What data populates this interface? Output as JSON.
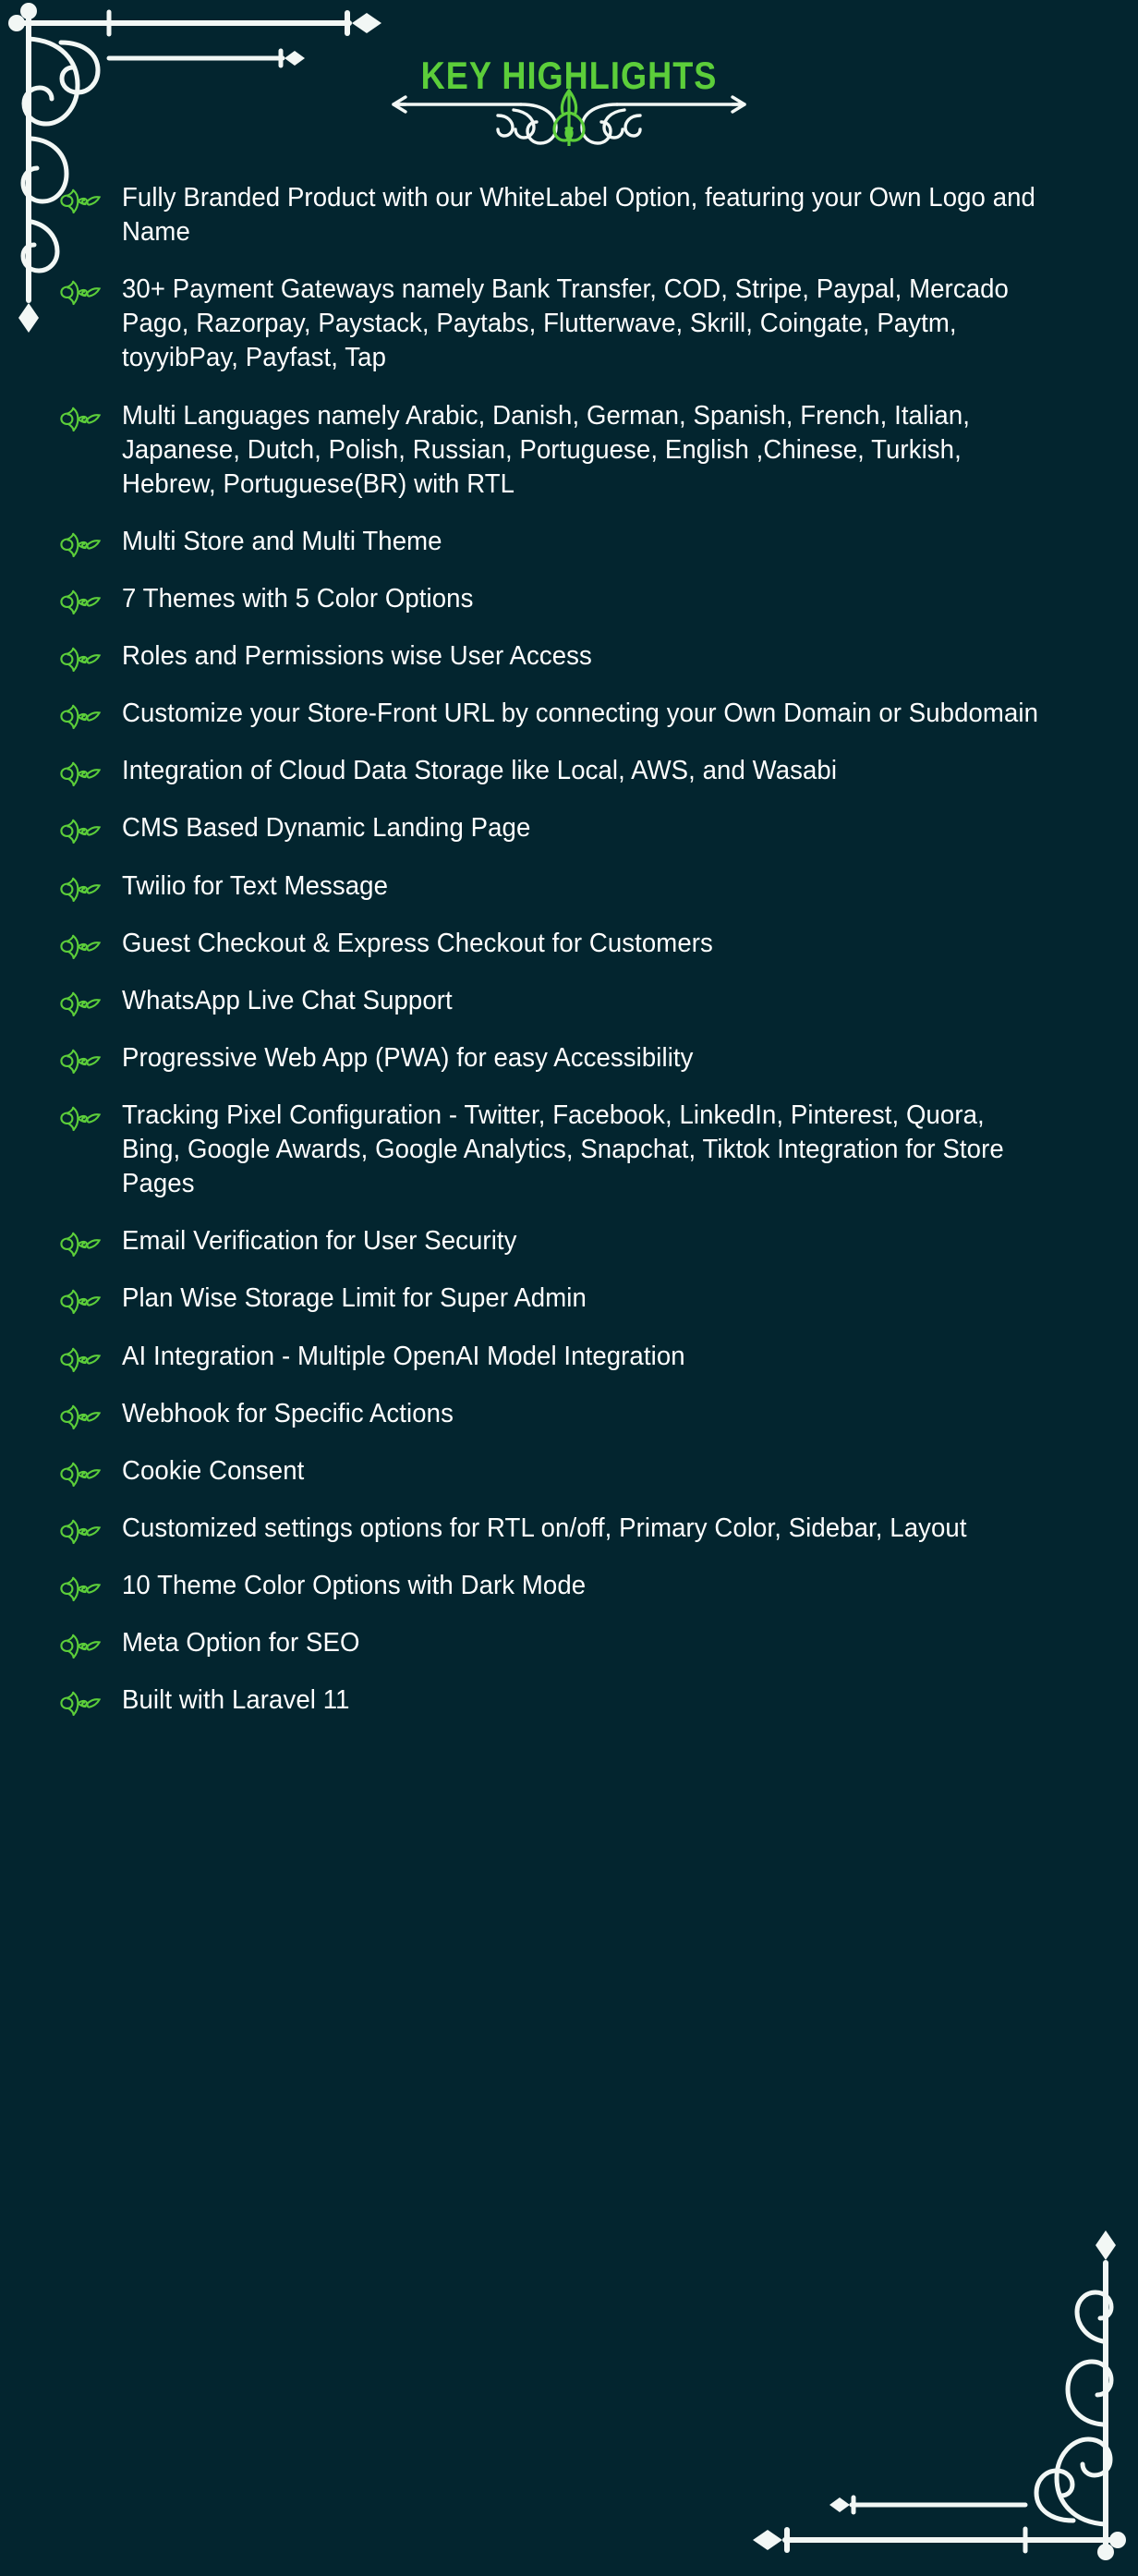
{
  "theme": {
    "background_color": "#03252f",
    "accent_color": "#5cce3a",
    "text_color": "#ffffff",
    "ornament_color": "#f2f7f5"
  },
  "header": {
    "title": "KEY HIGHLIGHTS",
    "divider_icon": "ornamental-fleur-divider",
    "corner_top_left_icon": "ornamental-corner-flourish",
    "corner_bottom_right_icon": "ornamental-corner-flourish"
  },
  "bullet_icon_name": "ornamental-flourish-bullet",
  "highlights": [
    {
      "text": "Fully Branded Product with our WhiteLabel Option, featuring your Own Logo and Name"
    },
    {
      "text": "30+ Payment Gateways namely Bank Transfer, COD, Stripe, Paypal, Mercado Pago, Razorpay, Paystack, Paytabs, Flutterwave, Skrill, Coingate, Paytm, toyyibPay, Payfast, Tap"
    },
    {
      "text": "Multi Languages namely Arabic, Danish, German, Spanish, French, Italian, Japanese, Dutch, Polish, Russian, Portuguese, English ,Chinese, Turkish, Hebrew, Portuguese(BR) with RTL"
    },
    {
      "text": "Multi Store and Multi Theme"
    },
    {
      "text": "7 Themes with 5 Color Options"
    },
    {
      "text": "Roles and Permissions wise User Access"
    },
    {
      "text": "Customize your Store-Front URL by connecting your Own Domain or Subdomain"
    },
    {
      "text": "Integration of Cloud Data Storage like Local, AWS, and Wasabi"
    },
    {
      "text": "CMS Based Dynamic Landing Page"
    },
    {
      "text": "Twilio for Text Message"
    },
    {
      "text": "Guest Checkout & Express Checkout for Customers"
    },
    {
      "text": "WhatsApp Live Chat Support"
    },
    {
      "text": "Progressive Web App (PWA) for easy Accessibility"
    },
    {
      "text": "Tracking Pixel Configuration - Twitter, Facebook, LinkedIn, Pinterest, Quora, Bing, Google Awards, Google Analytics, Snapchat, Tiktok Integration for Store Pages"
    },
    {
      "text": "Email Verification for User Security"
    },
    {
      "text": "Plan Wise Storage Limit for Super Admin"
    },
    {
      "text": "AI Integration - Multiple OpenAI Model Integration"
    },
    {
      "text": "Webhook for Specific Actions"
    },
    {
      "text": "Cookie Consent"
    },
    {
      "text": "Customized settings options for RTL on/off, Primary Color, Sidebar, Layout"
    },
    {
      "text": "10 Theme Color Options with Dark Mode"
    },
    {
      "text": "Meta Option for SEO"
    },
    {
      "text": "Built with Laravel 11"
    }
  ]
}
